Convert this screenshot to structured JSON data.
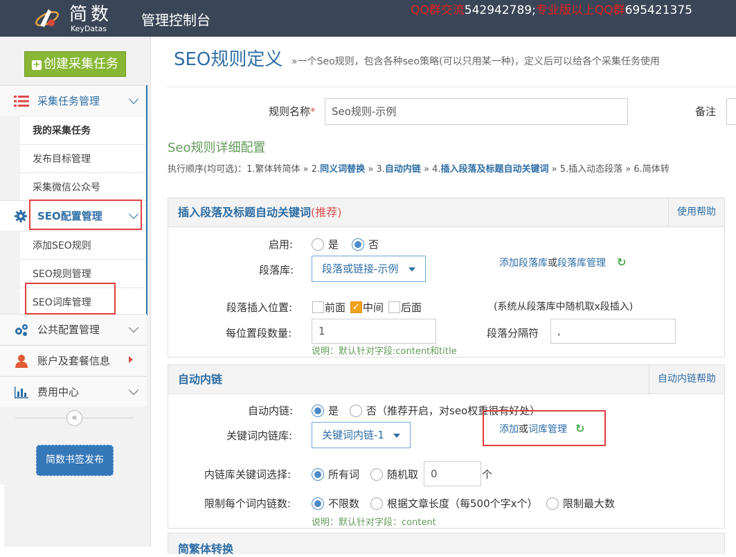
{
  "header": {
    "logo_text": "简数",
    "logo_sub": "KeyDatas",
    "app_title": "管理控制台",
    "qq_label_1": "QQ群交流",
    "qq_number_1": "542942789;",
    "qq_label_2": "专业版以上QQ群",
    "qq_number_2": "695421375"
  },
  "sidebar": {
    "create_button": "创建采集任务",
    "sections": [
      {
        "label": "采集任务管理",
        "icon": "list-icon"
      },
      {
        "label": "SEO配置管理",
        "icon": "gear-icon"
      },
      {
        "label": "公共配置管理",
        "icon": "gears-icon"
      },
      {
        "label": "账户及套餐信息",
        "icon": "user-icon"
      },
      {
        "label": "费用中心",
        "icon": "bar-chart-icon"
      }
    ],
    "task_items": [
      "我的采集任务",
      "发布目标管理",
      "采集微信公众号"
    ],
    "seo_items": [
      "添加SEO规则",
      "SEO规则管理",
      "SEO词库管理"
    ],
    "collapse_icon": "«",
    "bookmark_button": "简数书签发布"
  },
  "page": {
    "title": "SEO规则定义",
    "description": "»一个Seo规则，包含各种seo策略(可以只用某一种)，定义后可以给各个采集任务使用",
    "rule_name_label": "规则名称",
    "required_mark": "*",
    "rule_name_value": "Seo规则-示例",
    "remark_label": "备注",
    "detail_title": "Seo规则详细配置",
    "order_prefix": "执行顺序(均可选)：1.繁体转简体 » 2.",
    "order_step2": "同义词替换",
    "order_mid1": " » 3.",
    "order_step3": "自动内链",
    "order_mid2": " » 4.",
    "order_step4": "插入段落及标题自动关键词",
    "order_suffix": " » 5.插入动态段落 » 6.简体转"
  },
  "panel_paragraph": {
    "title": "插入段落及标题自动关键词",
    "title_note": "(推荐)",
    "help": "使用帮助",
    "enable_label": "启用:",
    "yes": "是",
    "no": "否",
    "lib_label": "段落库:",
    "lib_value": "段落或链接-示例",
    "add_lib": "添加段落库",
    "or": "或",
    "manage_lib": "段落库管理",
    "position_label": "段落插入位置:",
    "pos_front": "前面",
    "pos_middle": "中间",
    "pos_back": "后面",
    "position_note": "(系统从段落库中随机取x段插入)",
    "count_label": "每位置段数量:",
    "count_value": "1",
    "separator_label": "段落分隔符",
    "separator_value": ",",
    "note": "说明：默认针对字段:content和title"
  },
  "panel_links": {
    "title": "自动内链",
    "help": "自动内链帮助",
    "auto_label": "自动内链:",
    "yes": "是",
    "no_recommend": "否（推荐开启，对seo权重很有好处）",
    "lib_label": "关键词内链库:",
    "lib_value": "关键词内链-1",
    "add": "添加",
    "or": "或",
    "manage": "词库管理",
    "select_label": "内链库关键词选择:",
    "all_words": "所有词",
    "random": "随机取",
    "random_value": "0",
    "unit": "个",
    "limit_label": "限制每个词内链数:",
    "unlimited": "不限数",
    "by_length": "根据文章长度（每500个字x个）",
    "max_limit": "限制最大数",
    "note": "说明：默认针对字段：content"
  },
  "panel_next": {
    "title": "简繁体转换"
  },
  "colors": {
    "topbar": "#3a4657",
    "accent_blue": "#2e6ea6",
    "green_button": "#87b735",
    "highlight_red": "#e23d3d",
    "note_green": "#629b58"
  }
}
